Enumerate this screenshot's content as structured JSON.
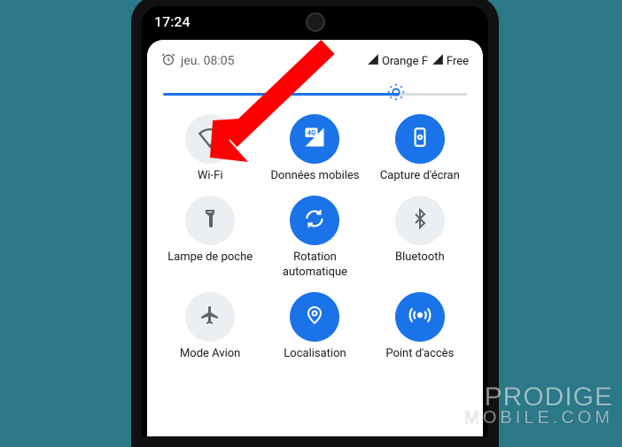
{
  "status_bar": {
    "time": "17:24"
  },
  "panel_header": {
    "alarm_icon": "alarm-icon",
    "date": "jeu. 08:05",
    "carriers": [
      {
        "name": "Orange F"
      },
      {
        "name": "Free"
      }
    ]
  },
  "brightness": {
    "percent": 76
  },
  "tiles": [
    {
      "id": "wifi",
      "label": "Wi-Fi",
      "on": false,
      "icon": "wifi-icon"
    },
    {
      "id": "data",
      "label": "Données mobiles",
      "on": true,
      "icon": "data-4g-icon"
    },
    {
      "id": "screenshot",
      "label": "Capture d'écran",
      "on": true,
      "icon": "screenshot-icon"
    },
    {
      "id": "flashlight",
      "label": "Lampe de poche",
      "on": false,
      "icon": "flashlight-icon"
    },
    {
      "id": "rotation",
      "label": "Rotation automatique",
      "on": true,
      "icon": "rotation-icon"
    },
    {
      "id": "bluetooth",
      "label": "Bluetooth",
      "on": false,
      "icon": "bluetooth-icon"
    },
    {
      "id": "airplane",
      "label": "Mode Avion",
      "on": false,
      "icon": "airplane-icon"
    },
    {
      "id": "location",
      "label": "Localisation",
      "on": true,
      "icon": "location-icon"
    },
    {
      "id": "hotspot",
      "label": "Point d'accès",
      "on": true,
      "icon": "hotspot-icon"
    }
  ],
  "watermark": {
    "line1": "PRODIGE",
    "line2": "MOBILE.COM"
  }
}
